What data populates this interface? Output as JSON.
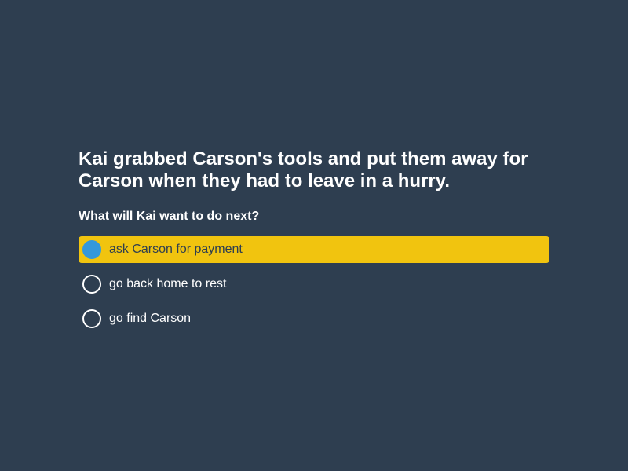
{
  "question": {
    "text": "Kai grabbed Carson's tools and put them away for Carson when they had to leave in a hurry.",
    "prompt": "What will Kai want to do next?"
  },
  "options": [
    {
      "label": "ask Carson for payment",
      "selected": true
    },
    {
      "label": "go back home to rest",
      "selected": false
    },
    {
      "label": "go find Carson",
      "selected": false
    }
  ],
  "colors": {
    "background": "#2e3e50",
    "selected_highlight": "#f1c40f",
    "selected_radio": "#3498db",
    "text": "#ffffff"
  }
}
